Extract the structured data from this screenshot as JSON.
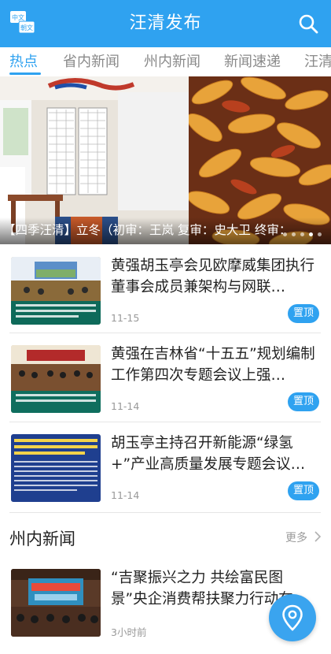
{
  "header": {
    "title": "汪清发布",
    "lang_icon_top": "中文",
    "lang_icon_bottom": "朝文"
  },
  "tabs": [
    {
      "label": "热点",
      "active": true
    },
    {
      "label": "省内新闻",
      "active": false
    },
    {
      "label": "州内新闻",
      "active": false
    },
    {
      "label": "新闻速递",
      "active": false
    },
    {
      "label": "汪清",
      "active": false
    }
  ],
  "banner": {
    "caption": "【四季汪清】立冬（初审：王岚 复审：史大卫 终审：",
    "slide_count": 5,
    "active_slide": 4
  },
  "news": [
    {
      "headline": "黄强胡玉亭会见欧摩威集团执行董事会成员兼架构与网联…",
      "date": "11-15",
      "badge": "置顶"
    },
    {
      "headline": "黄强在吉林省“十五五”规划编制工作第四次专题会议上强…",
      "date": "11-14",
      "badge": "置顶"
    },
    {
      "headline": "胡玉亭主持召开新能源“绿氢+”产业高质量发展专题会议…",
      "date": "11-14",
      "badge": "置顶"
    }
  ],
  "section": {
    "title": "州内新闻",
    "more_label": "更多"
  },
  "section_news": [
    {
      "headline": "“吉聚振兴之力 共绘富民图景”央企消费帮扶聚力行动在延…",
      "time": "3小时前"
    }
  ],
  "colors": {
    "accent": "#2fa2f0",
    "text": "#222222",
    "muted": "#999999"
  }
}
